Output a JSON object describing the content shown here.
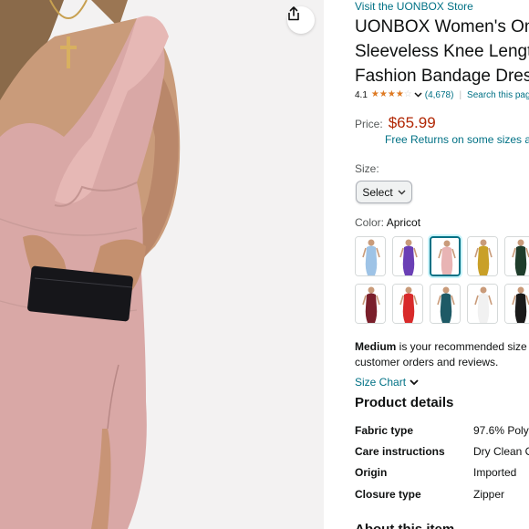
{
  "store_link": "Visit the UONBOX Store",
  "title_lines": [
    "UONBOX Women's One",
    "Sleeveless Knee Length",
    "Fashion Bandage Dress"
  ],
  "rating": {
    "value": "4.1",
    "stars": 4.1,
    "count": "(4,678)",
    "separator": "|",
    "search_link": "Search this page"
  },
  "price": {
    "label": "Price:",
    "amount": "$65.99",
    "returns": "Free Returns on some sizes and colors"
  },
  "size": {
    "label": "Size:",
    "select_label": "Select"
  },
  "color": {
    "label": "Color:",
    "selected": "Apricot",
    "swatches": [
      {
        "name": "light-blue",
        "color": "#9ec3e6",
        "selected": false
      },
      {
        "name": "purple",
        "color": "#6a3fb5",
        "selected": false
      },
      {
        "name": "apricot",
        "color": "#e8b4b4",
        "selected": true
      },
      {
        "name": "mustard",
        "color": "#c9a028",
        "selected": false
      },
      {
        "name": "dark-green",
        "color": "#1f3d2b",
        "selected": false
      },
      {
        "name": "wine",
        "color": "#7a1f2b",
        "selected": false
      },
      {
        "name": "red",
        "color": "#d82a2a",
        "selected": false
      },
      {
        "name": "teal",
        "color": "#1e5a66",
        "selected": false
      },
      {
        "name": "white",
        "color": "#f1f1f1",
        "selected": false
      },
      {
        "name": "black",
        "color": "#1a1a1a",
        "selected": false
      }
    ]
  },
  "size_note": {
    "bold": "Medium",
    "line1_rest": " is your recommended size b",
    "line2": "customer orders and reviews."
  },
  "size_chart": "Size Chart",
  "product_details": {
    "title": "Product details",
    "rows": [
      {
        "key": "Fabric type",
        "value": "97.6% Poly"
      },
      {
        "key": "Care instructions",
        "value": "Dry Clean O"
      },
      {
        "key": "Origin",
        "value": "Imported"
      },
      {
        "key": "Closure type",
        "value": "Zipper"
      }
    ]
  },
  "about_title": "About this item",
  "colors": {
    "link": "#007185",
    "price": "#b12704",
    "star": "#de7921",
    "dress": "#d9a8a6"
  }
}
